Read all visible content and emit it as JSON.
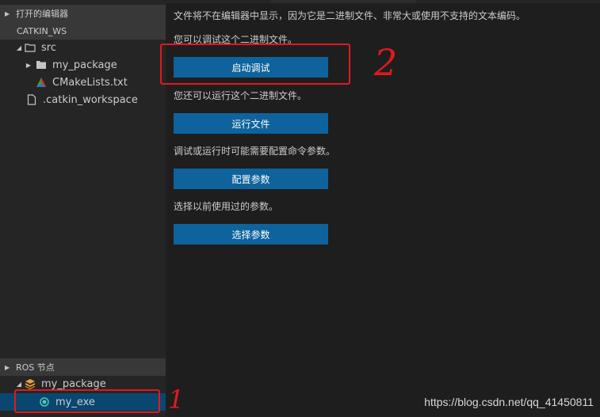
{
  "sidebar": {
    "open_editors_label": "打开的编辑器",
    "workspace_label": "CATKIN_WS",
    "tree": [
      {
        "label": "src",
        "icon": "folder-open-icon"
      },
      {
        "label": "my_package",
        "icon": "folder-icon"
      },
      {
        "label": "CMakeLists.txt",
        "icon": "cmake-icon"
      },
      {
        "label": ".catkin_workspace",
        "icon": "file-icon"
      }
    ],
    "ros_nodes_label": "ROS 节点",
    "ros_tree": [
      {
        "label": "my_package",
        "icon": "package-icon"
      },
      {
        "label": "my_exe",
        "icon": "node-icon"
      }
    ]
  },
  "main": {
    "binary_message": "文件将不在编辑器中显示，因为它是二进制文件、非常大或使用不支持的文本编码。",
    "debug_prompt": "您可以调试这个二进制文件。",
    "start_debug_label": "启动调试",
    "run_prompt": "您还可以运行这个二进制文件。",
    "run_file_label": "运行文件",
    "config_prompt": "调试或运行时可能需要配置命令参数。",
    "configure_args_label": "配置参数",
    "select_prompt": "选择以前使用过的参数。",
    "select_args_label": "选择参数"
  },
  "annotations": {
    "number_1": "1",
    "number_2": "2"
  },
  "watermark": "https://blog.csdn.net/qq_41450811",
  "colors": {
    "button": "#0e639c",
    "selection": "#094771",
    "annotation": "#e0191f"
  }
}
